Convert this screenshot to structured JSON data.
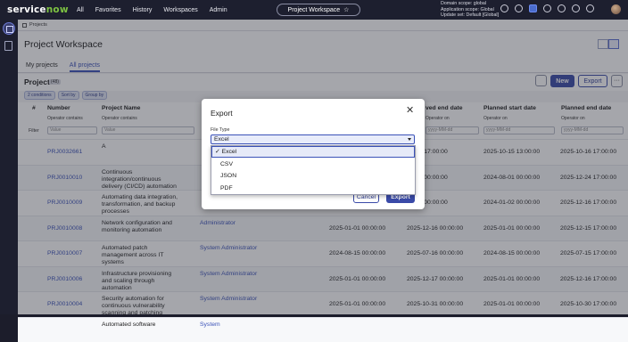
{
  "topbar": {
    "logo_a": "service",
    "logo_b": "now",
    "nav": [
      "All",
      "Favorites",
      "History",
      "Workspaces",
      "Admin"
    ],
    "workspace_pill": "Project Workspace",
    "scope_lines": [
      "Domain scope: global",
      "Application scope: Global",
      "Update set: Default [Global]"
    ]
  },
  "breadcrumb": "Projects",
  "page_title": "Project Workspace",
  "tabs": [
    "My projects",
    "All projects"
  ],
  "list": {
    "title": "Project",
    "count": "(48)",
    "new_label": "New",
    "export_label": "Export",
    "more_label": "···",
    "chips": [
      "2 conditions",
      "Sort by",
      "Group by"
    ]
  },
  "table": {
    "headers": [
      "#",
      "Number",
      "Project Name",
      "",
      "ved end date",
      "Planned start date",
      "Planned end date"
    ],
    "operators": [
      "Operator contains",
      "Operator contains",
      "Operator on",
      "Operator on",
      "Operator on"
    ],
    "filter_label": "Filter",
    "placeholders": [
      "Value",
      "Value",
      "yyyy-MM-dd",
      "yyyy-MM-dd",
      "yyyy-MM-dd"
    ],
    "rows": [
      {
        "num": "PRJ0032661",
        "name": "A",
        "user": "",
        "d1": "",
        "d2": "10-15 17:00:00",
        "d3": "2025-10-15 13:00:00",
        "d4": "2025-10-16 17:00:00"
      },
      {
        "num": "PRJ0010010",
        "name": "Continuous integration/continuous delivery (CI/CD) automation",
        "user": "",
        "d1": "",
        "d2": "12-25 00:00:00",
        "d3": "2024-08-01 00:00:00",
        "d4": "2025-12-24 17:00:00"
      },
      {
        "num": "PRJ0010009",
        "name": "Automating data integration, transformation, and backup processes",
        "user": "",
        "d1": "",
        "d2": "12-17 00:00:00",
        "d3": "2024-01-02 00:00:00",
        "d4": "2025-12-16 17:00:00"
      },
      {
        "num": "PRJ0010008",
        "name": "Network configuration and monitoring automation",
        "user": "Administrator",
        "d1": "2025-01-01 00:00:00",
        "d2": "2025-12-16 00:00:00",
        "d3": "2025-01-01 00:00:00",
        "d4": "2025-12-15 17:00:00"
      },
      {
        "num": "PRJ0010007",
        "name": "Automated patch management across IT systems",
        "user": "System Administrator",
        "d1": "2024-08-15 00:00:00",
        "d2": "2025-07-16 00:00:00",
        "d3": "2024-08-15 00:00:00",
        "d4": "2025-07-15 17:00:00"
      },
      {
        "num": "PRJ0010006",
        "name": "Infrastructure provisioning and scaling through automation",
        "user": "System Administrator",
        "d1": "2025-01-01 00:00:00",
        "d2": "2025-12-17 00:00:00",
        "d3": "2025-01-01 00:00:00",
        "d4": "2025-12-16 17:00:00"
      },
      {
        "num": "PRJ0010004",
        "name": "Security automation for continuous vulnerability scanning and patching",
        "user": "System Administrator",
        "d1": "2025-01-01 00:00:00",
        "d2": "2025-10-31 00:00:00",
        "d3": "2025-01-01 00:00:00",
        "d4": "2025-10-30 17:00:00"
      },
      {
        "num": "",
        "name": "Automated software",
        "user": "System",
        "d1": "",
        "d2": "",
        "d3": "",
        "d4": ""
      }
    ]
  },
  "modal": {
    "title": "Export",
    "close": "✕",
    "file_type_label": "File Type",
    "selected": "Excel",
    "cancel": "Cancel",
    "export": "Export"
  },
  "dropdown": {
    "options": [
      "✓ Excel",
      "CSV",
      "JSON",
      "PDF"
    ]
  },
  "colors": {
    "brand": "#3a4aa8",
    "topbar": "#1d1f2f",
    "link": "#3b52b8",
    "logo_accent": "#7dc242"
  }
}
